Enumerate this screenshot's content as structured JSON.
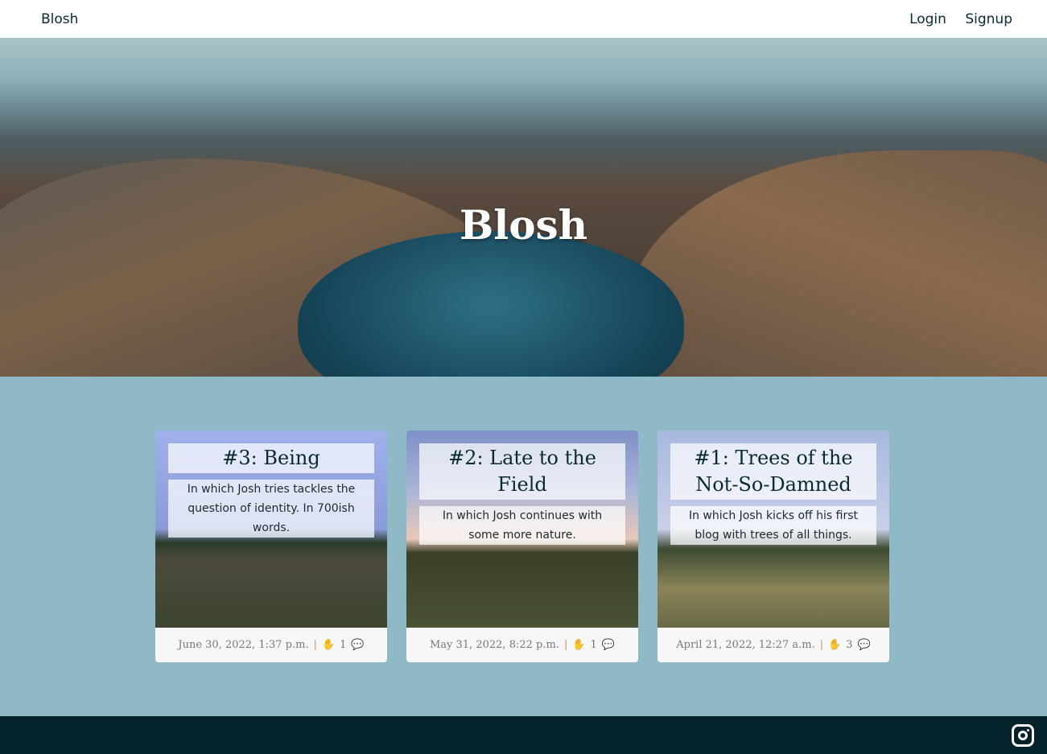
{
  "nav": {
    "brand": "Blosh",
    "login": "Login",
    "signup": "Signup"
  },
  "hero": {
    "title": "Blosh"
  },
  "posts": [
    {
      "title": "#3: Being",
      "summary": "In which Josh tries tackles the question of identity. In 700ish words.",
      "date": "June 30, 2022, 1:37 p.m.",
      "claps": "1"
    },
    {
      "title": "#2: Late to the Field",
      "summary": "In which Josh continues with some more nature.",
      "date": "May 31, 2022, 8:22 p.m.",
      "claps": "1"
    },
    {
      "title": "#1: Trees of the Not-So-Damned",
      "summary": "In which Josh kicks off his first blog with trees of all things.",
      "date": "April 21, 2022, 12:27 a.m.",
      "claps": "3"
    }
  ],
  "separator": "|"
}
